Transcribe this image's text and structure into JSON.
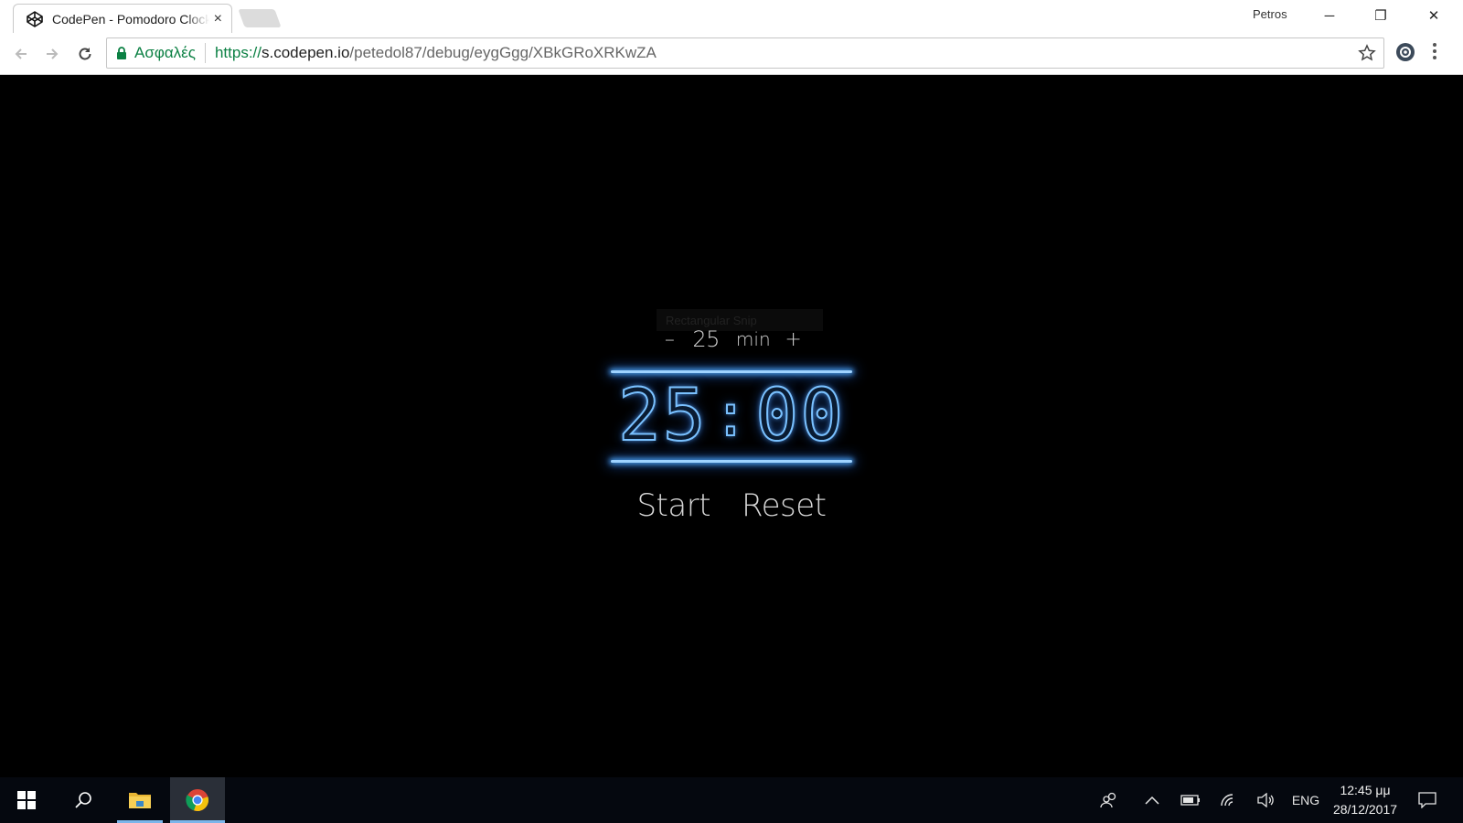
{
  "browser": {
    "tab_title": "CodePen - Pomodoro Clock",
    "tab_close": "×",
    "profile_name": "Petros",
    "window_buttons": {
      "minimize": "─",
      "restore": "❐",
      "close": "✕"
    },
    "security_label": "Ασφαλές",
    "url_scheme": "https://",
    "url_host": "s.codepen.io",
    "url_path": "/petedol87/debug/eygGgg/XBkGRoXRKwZA"
  },
  "page": {
    "snip_ghost": "Rectangular Snip",
    "session": {
      "minus": "–",
      "length": "25",
      "unit": "min",
      "plus": "+"
    },
    "clock": {
      "minutes": "25",
      "separator": ":",
      "seconds": "00"
    },
    "start_label": "Start",
    "reset_label": "Reset",
    "accent_color": "#7ac1ff"
  },
  "taskbar": {
    "language": "ENG",
    "time": "12:45 μμ",
    "date": "28/12/2017"
  }
}
